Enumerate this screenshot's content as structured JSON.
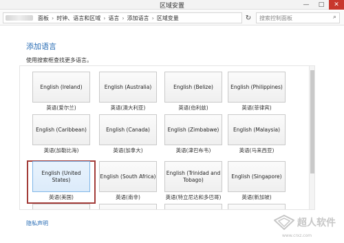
{
  "window": {
    "title": "区域安置",
    "minimize_label": "—",
    "maximize_label": "□",
    "close_label": "✕"
  },
  "address_bar": {
    "crumbs": [
      "面板",
      "时钟、语言和区域",
      "语言",
      "添加语言",
      "区域变量"
    ],
    "separator": "›",
    "search_placeholder": "搜索控制面板"
  },
  "content": {
    "title": "添加语言",
    "description": "使用搜索框查找更多语言。",
    "tiles": [
      {
        "label": "English (Ireland)",
        "caption": "英语(爱尔兰)"
      },
      {
        "label": "English (Australia)",
        "caption": "英语(澳大利亚)"
      },
      {
        "label": "English (Belize)",
        "caption": "英语(伯利兹)"
      },
      {
        "label": "English (Philippines)",
        "caption": "英语(菲律宾)"
      },
      {
        "label": "English (Caribbean)",
        "caption": "英语(加勒比海)"
      },
      {
        "label": "English (Canada)",
        "caption": "英语(加拿大)"
      },
      {
        "label": "English (Zimbabwe)",
        "caption": "英语(津巴布韦)"
      },
      {
        "label": "English (Malaysia)",
        "caption": "英语(马来西亚)"
      },
      {
        "label": "English (United States)",
        "caption": "英语(美国)"
      },
      {
        "label": "English (South Africa)",
        "caption": "英语(南非)"
      },
      {
        "label": "English (Trinidad and Tobago)",
        "caption": "英语(特立尼达和多巴哥)"
      },
      {
        "label": "English (Singapore)",
        "caption": "英语(新加坡)"
      }
    ]
  },
  "footer": {
    "privacy_link": "隐私声明"
  },
  "watermark": {
    "text": "超人软件",
    "url": "www.crxz.com"
  }
}
